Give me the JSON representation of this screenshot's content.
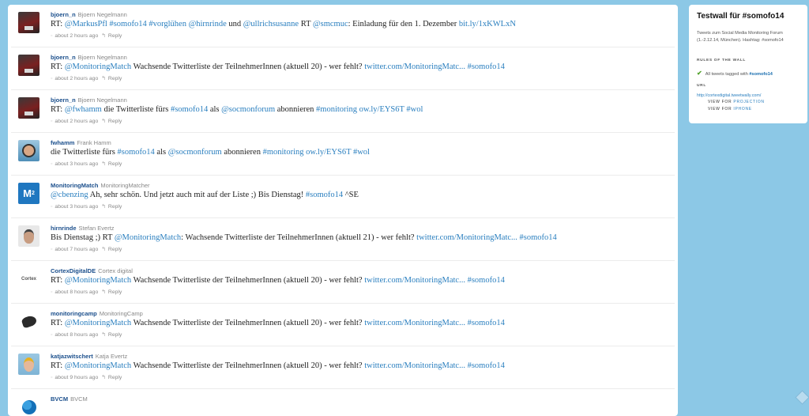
{
  "tweets": [
    {
      "username": "bjoern_n",
      "fullname": "Bjoern Negelmann",
      "avatar": "av-bjoern",
      "segments": [
        {
          "t": "RT: "
        },
        {
          "t": "@MarkusPfl",
          "l": true
        },
        {
          "t": " "
        },
        {
          "t": "#somofo14",
          "l": true
        },
        {
          "t": " "
        },
        {
          "t": "#vorglühen",
          "l": true
        },
        {
          "t": " "
        },
        {
          "t": "@hirnrinde",
          "l": true
        },
        {
          "t": " und "
        },
        {
          "t": "@ullrichsusanne",
          "l": true
        },
        {
          "t": " RT "
        },
        {
          "t": "@smcmuc",
          "l": true
        },
        {
          "t": ": Einladung für den 1. Dezember "
        },
        {
          "t": "bit.ly/1xKWLxN",
          "l": true
        }
      ],
      "time": "about 2 hours ago",
      "reply": "Reply"
    },
    {
      "username": "bjoern_n",
      "fullname": "Bjoern Negelmann",
      "avatar": "av-bjoern",
      "segments": [
        {
          "t": "RT: "
        },
        {
          "t": "@MonitoringMatch",
          "l": true
        },
        {
          "t": " Wachsende Twitterliste der TeilnehmerInnen (aktuell 20) - wer fehlt? "
        },
        {
          "t": "twitter.com/MonitoringMatc...",
          "l": true
        },
        {
          "t": " "
        },
        {
          "t": "#somofo14",
          "l": true
        }
      ],
      "time": "about 2 hours ago",
      "reply": "Reply"
    },
    {
      "username": "bjoern_n",
      "fullname": "Bjoern Negelmann",
      "avatar": "av-bjoern",
      "segments": [
        {
          "t": "RT: "
        },
        {
          "t": "@fwhamm",
          "l": true
        },
        {
          "t": " die Twitterliste fürs "
        },
        {
          "t": "#somofo14",
          "l": true
        },
        {
          "t": " als "
        },
        {
          "t": "@socmonforum",
          "l": true
        },
        {
          "t": " abonnieren "
        },
        {
          "t": "#monitoring",
          "l": true
        },
        {
          "t": " "
        },
        {
          "t": "ow.ly/EYS6T",
          "l": true
        },
        {
          "t": " "
        },
        {
          "t": "#wol",
          "l": true
        }
      ],
      "time": "about 2 hours ago",
      "reply": "Reply"
    },
    {
      "username": "fwhamm",
      "fullname": "Frank Hamm",
      "avatar": "av-frank",
      "segments": [
        {
          "t": "die Twitterliste fürs "
        },
        {
          "t": "#somofo14",
          "l": true
        },
        {
          "t": " als "
        },
        {
          "t": "@socmonforum",
          "l": true
        },
        {
          "t": " abonnieren "
        },
        {
          "t": "#monitoring",
          "l": true
        },
        {
          "t": " "
        },
        {
          "t": "ow.ly/EYS6T",
          "l": true
        },
        {
          "t": " "
        },
        {
          "t": "#wol",
          "l": true
        }
      ],
      "time": "about 3 hours ago",
      "reply": "Reply"
    },
    {
      "username": "MonitoringMatch",
      "fullname": "MonitoringMatcher",
      "avatar": "av-mm",
      "segments": [
        {
          "t": "@cbenzing",
          "l": true
        },
        {
          "t": " Ah, sehr schön. Und jetzt auch mit auf der Liste ;) Bis Dienstag! "
        },
        {
          "t": "#somofo14",
          "l": true
        },
        {
          "t": " ^SE"
        }
      ],
      "time": "about 3 hours ago",
      "reply": "Reply"
    },
    {
      "username": "hirnrinde",
      "fullname": "Stefan Evertz",
      "avatar": "av-stefan",
      "segments": [
        {
          "t": "Bis Dienstag ;) RT "
        },
        {
          "t": "@MonitoringMatch",
          "l": true
        },
        {
          "t": ": Wachsende Twitterliste der TeilnehmerInnen (aktuell 21) - wer fehlt? "
        },
        {
          "t": "twitter.com/MonitoringMatc...",
          "l": true
        },
        {
          "t": " "
        },
        {
          "t": "#somofo14",
          "l": true
        }
      ],
      "time": "about 7 hours ago",
      "reply": "Reply"
    },
    {
      "username": "CortexDigitalDE",
      "fullname": "Cortex digital",
      "avatar": "av-cortex",
      "segments": [
        {
          "t": "RT: "
        },
        {
          "t": "@MonitoringMatch",
          "l": true
        },
        {
          "t": " Wachsende Twitterliste der TeilnehmerInnen (aktuell 20) - wer fehlt? "
        },
        {
          "t": "twitter.com/MonitoringMatc...",
          "l": true
        },
        {
          "t": " "
        },
        {
          "t": "#somofo14",
          "l": true
        }
      ],
      "time": "about 8 hours ago",
      "reply": "Reply"
    },
    {
      "username": "monitoringcamp",
      "fullname": "MonitoringCamp",
      "avatar": "av-camp",
      "segments": [
        {
          "t": "RT: "
        },
        {
          "t": "@MonitoringMatch",
          "l": true
        },
        {
          "t": " Wachsende Twitterliste der TeilnehmerInnen (aktuell 20) - wer fehlt? "
        },
        {
          "t": "twitter.com/MonitoringMatc...",
          "l": true
        },
        {
          "t": " "
        },
        {
          "t": "#somofo14",
          "l": true
        }
      ],
      "time": "about 8 hours ago",
      "reply": "Reply"
    },
    {
      "username": "katjazwitschert",
      "fullname": "Katja Evertz",
      "avatar": "av-katja",
      "segments": [
        {
          "t": "RT: "
        },
        {
          "t": "@MonitoringMatch",
          "l": true
        },
        {
          "t": " Wachsende Twitterliste der TeilnehmerInnen (aktuell 20) - wer fehlt? "
        },
        {
          "t": "twitter.com/MonitoringMatc...",
          "l": true
        },
        {
          "t": " "
        },
        {
          "t": "#somofo14",
          "l": true
        }
      ],
      "time": "about 9 hours ago",
      "reply": "Reply"
    },
    {
      "username": "BVCM",
      "fullname": "BVCM",
      "avatar": "av-bvcm",
      "segments": [],
      "time": "",
      "reply": ""
    }
  ],
  "sidebar": {
    "title": "Testwall für #somofo14",
    "description": "Tweets zum Social Media Monitoring Forum (1.-2.12.14, München). Hashtag: #somofo14",
    "rules_heading": "RULES OF THE WALL",
    "rule_text": "All tweets tagged with ",
    "rule_tag": "#somofo14",
    "url_heading": "URL",
    "url": "http://cortexdigital.tweetwally.com/",
    "view_for": "VIEW FOR",
    "projection": "PROJECTION",
    "iphone": "IPHONE"
  },
  "icons": {
    "check": "check-icon",
    "reply": "reply-icon",
    "time": "time-icon",
    "corner": "corner-icon"
  }
}
